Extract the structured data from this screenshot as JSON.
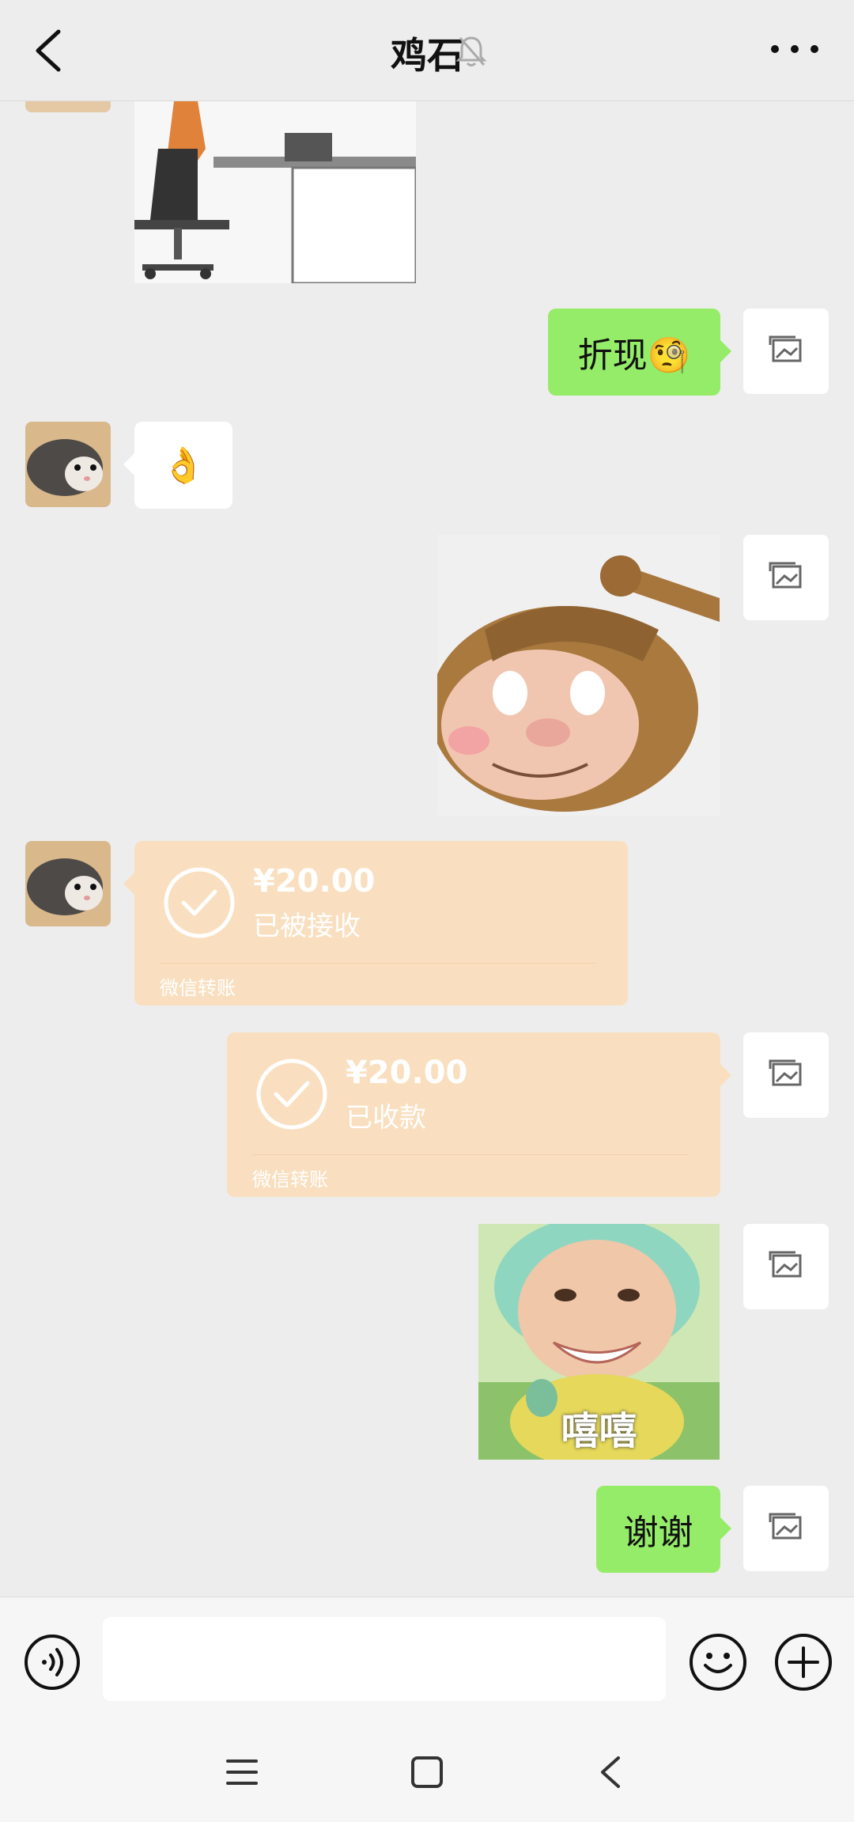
{
  "header": {
    "title": "鸡石",
    "back_icon": "chevron-left-icon",
    "mute_icon": "bell-off-icon",
    "more_icon": "more-dots-icon"
  },
  "messages": [
    {
      "type": "image",
      "from": "other",
      "description_icon": "gif-office-chair"
    },
    {
      "type": "text",
      "from": "self",
      "text": "折现🧐"
    },
    {
      "type": "text",
      "from": "other",
      "text": "👌"
    },
    {
      "type": "sticker",
      "from": "self",
      "icon": "pig-sticker"
    },
    {
      "type": "transfer",
      "from": "other",
      "amount": "¥20.00",
      "status": "已被接收",
      "label": "微信转账"
    },
    {
      "type": "transfer",
      "from": "self",
      "amount": "¥20.00",
      "status": "已收款",
      "label": "微信转账"
    },
    {
      "type": "sticker",
      "from": "self",
      "caption": "嘻嘻"
    },
    {
      "type": "text",
      "from": "self",
      "text": "谢谢"
    }
  ],
  "input_bar": {
    "voice_icon": "voice-icon",
    "input_value": "",
    "emoji_icon": "emoji-icon",
    "plus_icon": "plus-icon"
  },
  "nav_bar": {
    "menu_icon": "menu-icon",
    "home_icon": "home-icon",
    "back_icon": "back-icon"
  },
  "colors": {
    "background": "#ededed",
    "self_bubble": "#95ec69",
    "other_bubble": "#ffffff",
    "transfer_card": "#f9dfbf"
  }
}
